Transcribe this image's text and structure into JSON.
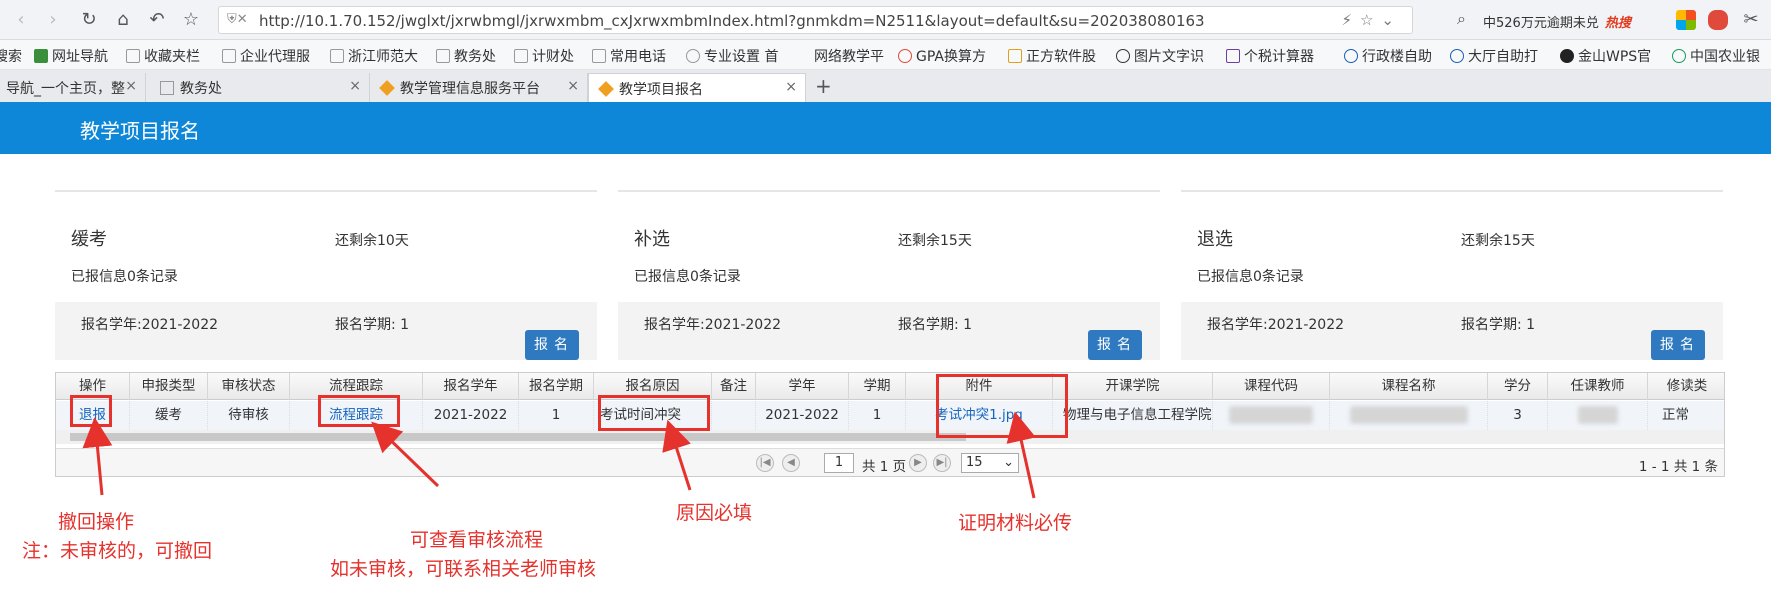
{
  "browser": {
    "url": "http://10.1.70.152/jwglxt/jxrwbmgl/jxrwxmbm_cxJxrwxmbmIndex.html?gnmkdm=N2511&layout=default&su=202038080163",
    "search_text": "中526万元逾期未兑",
    "search_hot": "热搜",
    "bookmarks": [
      "搜索",
      "网址导航",
      "收藏夹栏",
      "企业代理服",
      "浙江师范大",
      "教务处",
      "计财处",
      "常用电话",
      "专业设置 首",
      "网络教学平",
      "GPA换算方",
      "正方软件股",
      "图片文字识",
      "个税计算器",
      "行政楼自助",
      "大厅自助打",
      "金山WPS官",
      "中国农业银"
    ],
    "tabs": [
      {
        "label": "导航_一个主页，整",
        "active": false
      },
      {
        "label": "教务处",
        "active": false
      },
      {
        "label": "教学管理信息服务平台",
        "active": false
      },
      {
        "label": "教学项目报名",
        "active": true
      }
    ]
  },
  "app": {
    "title": "教学项目报名"
  },
  "cards": [
    {
      "title": "缓考",
      "remaining": "还剩余10天",
      "count": "已报信息0条记录",
      "year": "报名学年:2021-2022",
      "term": "报名学期: 1",
      "button": "报名"
    },
    {
      "title": "补选",
      "remaining": "还剩余15天",
      "count": "已报信息0条记录",
      "year": "报名学年:2021-2022",
      "term": "报名学期: 1",
      "button": "报名"
    },
    {
      "title": "退选",
      "remaining": "还剩余15天",
      "count": "已报信息0条记录",
      "year": "报名学年:2021-2022",
      "term": "报名学期: 1",
      "button": "报名"
    }
  ],
  "table": {
    "headers": [
      "操作",
      "申报类型",
      "审核状态",
      "流程跟踪",
      "报名学年",
      "报名学期",
      "报名原因",
      "备注",
      "学年",
      "学期",
      "附件",
      "开课学院",
      "课程代码",
      "课程名称",
      "学分",
      "任课教师",
      "修读类"
    ],
    "row": {
      "action": "退报",
      "type": "缓考",
      "status": "待审核",
      "track": "流程跟踪",
      "year": "2021-2022",
      "term": "1",
      "reason": "考试时间冲突",
      "remark": "",
      "ay": "2021-2022",
      "sem": "1",
      "attachment": "考试冲突1.jpg",
      "college": "物理与电子信息工程学院",
      "credit": "3",
      "mode": "正常"
    },
    "pager": {
      "page": "1",
      "total": "共 1 页",
      "size": "15",
      "summary": "1 - 1   共 1 条"
    }
  },
  "annotations": {
    "withdraw": "撤回操作",
    "withdraw_note": "注：未审核的，可撤回",
    "track_1": "可查看审核流程",
    "track_2": "如未审核，可联系相关老师审核",
    "reason": "原因必填",
    "attachment": "证明材料必传"
  }
}
